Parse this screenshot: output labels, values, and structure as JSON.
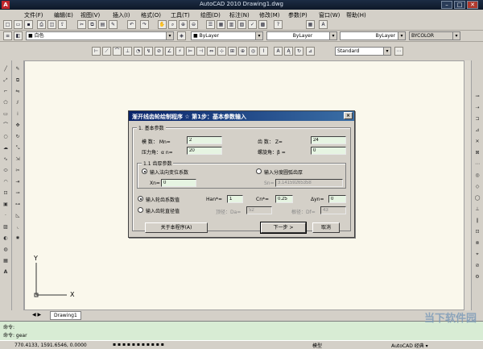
{
  "window": {
    "title": "AutoCAD 2010   Drawing1.dwg"
  },
  "menu": [
    "文件(F)",
    "编辑(E)",
    "视图(V)",
    "插入(I)",
    "格式(O)",
    "工具(T)",
    "绘图(D)",
    "标注(N)",
    "修改(M)",
    "参数(P)",
    "窗口(W)",
    "帮助(H)"
  ],
  "toolbar": {
    "layer_combo": "■ 白色",
    "color_combo": "■ ByLayer",
    "linetype_combo": "ByLayer",
    "lineweight_combo": "ByLayer",
    "plotstyle_combo": "BYCOLOR",
    "style_combo": "Standard"
  },
  "dialog": {
    "title": "渐开线齿轮绘制程序  ☆  第1步：基本参数输入",
    "group_basic": "1. 基本参数",
    "module_label": "模  数： Mn=",
    "module_value": "2",
    "teeth_label": "齿  数： Z=",
    "teeth_value": "24",
    "pressure_label": "压力角：α n=",
    "pressure_value": "20",
    "helix_label": "螺旋角：β =",
    "helix_value": "0",
    "group_thickness": "1.1 齿厚参数",
    "radio_shift": "输入法向变位系数",
    "radio_arc": "输入分度圆弧齿厚",
    "xn_label": "Xn=",
    "xn_value": "0",
    "sn_label": "Sn=",
    "sn_value": "3.14159265358",
    "radio_coeff": "输入轮齿系数值",
    "radio_dia": "输入齿轮直径值",
    "han_label": "Han*=",
    "han_value": "1",
    "cn_label": "Cn*=",
    "cn_value": "0.25",
    "dyn_label": "Δyn=",
    "dyn_value": "0",
    "da_label": "顶径：Da=",
    "da_value": "52",
    "df_label": "根径：Df=",
    "df_value": "43",
    "about_button": "关于本程序(A)",
    "next_button": "下一步 >",
    "cancel_button": "取消"
  },
  "canvas": {
    "ucs_x": "X",
    "ucs_y": "Y"
  },
  "tabs": [
    "Drawing1"
  ],
  "command": {
    "line1": "命令:",
    "line2": "命令: gear"
  },
  "status": {
    "coords": "770.4133, 1591.6546, 0.0000",
    "model": "模型",
    "workspace": "AutoCAD 经典 ▾"
  },
  "watermark": "当下软件园"
}
